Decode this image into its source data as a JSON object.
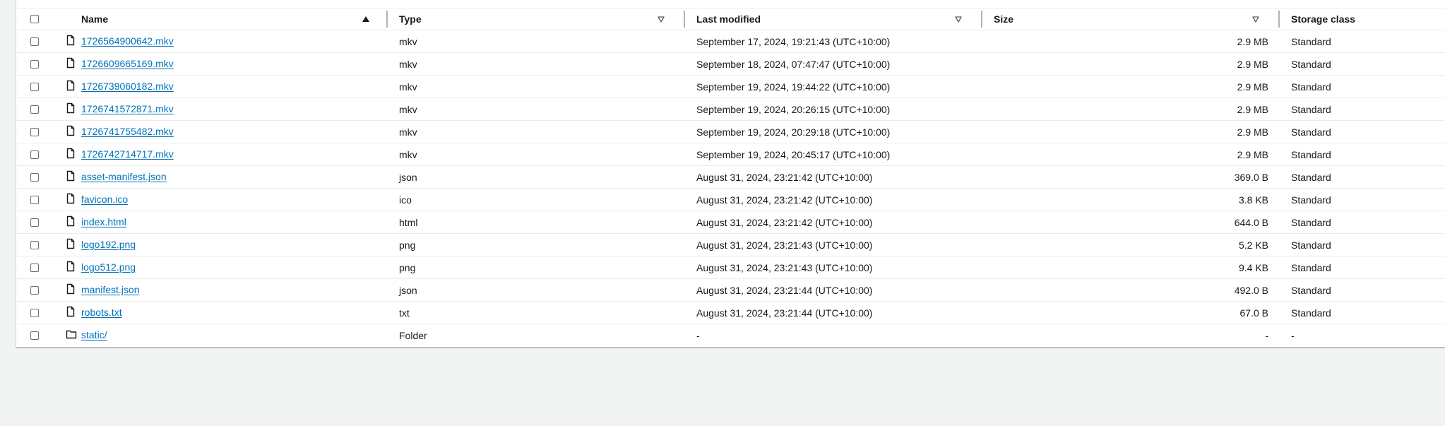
{
  "table": {
    "columns": {
      "name": "Name",
      "type": "Type",
      "last_modified": "Last modified",
      "size": "Size",
      "storage_class": "Storage class"
    },
    "rows": [
      {
        "name": "1726564900642.mkv",
        "type": "mkv",
        "last_modified": "September 17, 2024, 19:21:43 (UTC+10:00)",
        "size": "2.9 MB",
        "storage_class": "Standard",
        "icon": "file-icon"
      },
      {
        "name": "1726609665169.mkv",
        "type": "mkv",
        "last_modified": "September 18, 2024, 07:47:47 (UTC+10:00)",
        "size": "2.9 MB",
        "storage_class": "Standard",
        "icon": "file-icon"
      },
      {
        "name": "1726739060182.mkv",
        "type": "mkv",
        "last_modified": "September 19, 2024, 19:44:22 (UTC+10:00)",
        "size": "2.9 MB",
        "storage_class": "Standard",
        "icon": "file-icon"
      },
      {
        "name": "1726741572871.mkv",
        "type": "mkv",
        "last_modified": "September 19, 2024, 20:26:15 (UTC+10:00)",
        "size": "2.9 MB",
        "storage_class": "Standard",
        "icon": "file-icon"
      },
      {
        "name": "1726741755482.mkv",
        "type": "mkv",
        "last_modified": "September 19, 2024, 20:29:18 (UTC+10:00)",
        "size": "2.9 MB",
        "storage_class": "Standard",
        "icon": "file-icon"
      },
      {
        "name": "1726742714717.mkv",
        "type": "mkv",
        "last_modified": "September 19, 2024, 20:45:17 (UTC+10:00)",
        "size": "2.9 MB",
        "storage_class": "Standard",
        "icon": "file-icon"
      },
      {
        "name": "asset-manifest.json",
        "type": "json",
        "last_modified": "August 31, 2024, 23:21:42 (UTC+10:00)",
        "size": "369.0 B",
        "storage_class": "Standard",
        "icon": "file-icon"
      },
      {
        "name": "favicon.ico",
        "type": "ico",
        "last_modified": "August 31, 2024, 23:21:42 (UTC+10:00)",
        "size": "3.8 KB",
        "storage_class": "Standard",
        "icon": "file-icon"
      },
      {
        "name": "index.html",
        "type": "html",
        "last_modified": "August 31, 2024, 23:21:42 (UTC+10:00)",
        "size": "644.0 B",
        "storage_class": "Standard",
        "icon": "file-icon"
      },
      {
        "name": "logo192.png",
        "type": "png",
        "last_modified": "August 31, 2024, 23:21:43 (UTC+10:00)",
        "size": "5.2 KB",
        "storage_class": "Standard",
        "icon": "file-icon"
      },
      {
        "name": "logo512.png",
        "type": "png",
        "last_modified": "August 31, 2024, 23:21:43 (UTC+10:00)",
        "size": "9.4 KB",
        "storage_class": "Standard",
        "icon": "file-icon"
      },
      {
        "name": "manifest.json",
        "type": "json",
        "last_modified": "August 31, 2024, 23:21:44 (UTC+10:00)",
        "size": "492.0 B",
        "storage_class": "Standard",
        "icon": "file-icon"
      },
      {
        "name": "robots.txt",
        "type": "txt",
        "last_modified": "August 31, 2024, 23:21:44 (UTC+10:00)",
        "size": "67.0 B",
        "storage_class": "Standard",
        "icon": "file-icon"
      },
      {
        "name": "static/",
        "type": "Folder",
        "last_modified": "-",
        "size": "-",
        "storage_class": "-",
        "icon": "folder-icon"
      }
    ]
  },
  "colors": {
    "link": "#0073bb",
    "background": "#f2f3f3",
    "panel": "#ffffff",
    "border": "#eaeded"
  }
}
